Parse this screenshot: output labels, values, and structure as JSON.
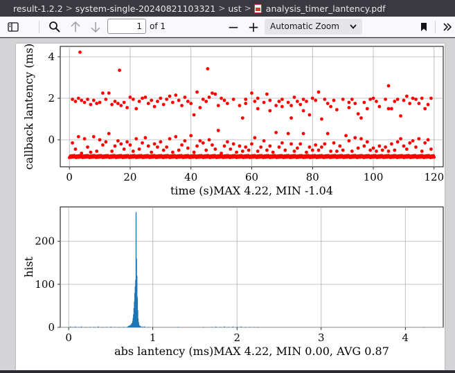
{
  "breadcrumb": {
    "items": [
      "result-1.2.2",
      "system-single-20240821103321",
      "ust"
    ],
    "file_name": "analysis_timer_lantency.pdf",
    "separator": ">"
  },
  "toolbar": {
    "page_number": "1",
    "page_count": "of 1",
    "zoom": "Automatic Zoom",
    "zoom_out_label": "−",
    "zoom_in_label": "+",
    "icons": [
      "sidebar-toggle-icon",
      "search-icon",
      "arrow-up-icon",
      "arrow-down-icon",
      "chevron-down-icon",
      "bookmark-icon",
      "double-chevron-right-icon"
    ]
  },
  "chart_data": [
    {
      "type": "scatter",
      "xlabel": "time (s)MAX 4.22, MIN -1.04",
      "ylabel": "callback lantency (ms)",
      "xlim": [
        -3,
        123
      ],
      "ylim": [
        -1.3,
        4.5
      ],
      "xticks": [
        0,
        20,
        40,
        60,
        80,
        100,
        120
      ],
      "yticks": [
        0,
        2,
        4
      ],
      "grid": true,
      "color": "#ff0000",
      "baseline": -0.8,
      "outliers": [
        [
          3.5,
          4.22
        ],
        [
          16.5,
          3.35
        ],
        [
          45.5,
          3.42
        ],
        [
          105,
          2.6
        ],
        [
          1,
          1.95
        ],
        [
          2,
          1.85
        ],
        [
          3,
          2.0
        ],
        [
          4,
          1.9
        ],
        [
          5,
          1.8
        ],
        [
          6,
          1.95
        ],
        [
          7,
          1.7
        ],
        [
          8,
          1.9
        ],
        [
          9,
          1.75
        ],
        [
          10,
          1.8
        ],
        [
          11,
          2.25
        ],
        [
          12,
          1.95
        ],
        [
          13,
          2.25
        ],
        [
          14,
          1.7
        ],
        [
          15,
          1.85
        ],
        [
          16,
          1.75
        ],
        [
          17,
          1.65
        ],
        [
          18,
          1.8
        ],
        [
          19,
          1.55
        ],
        [
          20,
          2.05
        ],
        [
          21,
          1.95
        ],
        [
          22,
          1.5
        ],
        [
          23,
          1.85
        ],
        [
          24,
          2.0
        ],
        [
          25,
          2.05
        ],
        [
          26,
          1.75
        ],
        [
          27,
          1.9
        ],
        [
          28,
          1.6
        ],
        [
          29,
          1.85
        ],
        [
          30,
          2.0
        ],
        [
          31,
          1.7
        ],
        [
          32,
          1.95
        ],
        [
          33,
          2.1
        ],
        [
          34,
          1.8
        ],
        [
          35,
          2.15
        ],
        [
          36,
          1.9
        ],
        [
          37,
          1.65
        ],
        [
          38,
          2.05
        ],
        [
          39,
          1.85
        ],
        [
          40,
          1.75
        ],
        [
          41,
          1.2
        ],
        [
          42,
          2.3
        ],
        [
          43,
          1.55
        ],
        [
          44,
          1.95
        ],
        [
          45,
          1.85
        ],
        [
          46,
          2.05
        ],
        [
          47,
          2.25
        ],
        [
          48,
          2.2
        ],
        [
          50,
          2.0
        ],
        [
          52,
          1.75
        ],
        [
          54,
          1.95
        ],
        [
          56,
          1.65
        ],
        [
          57,
          1.05
        ],
        [
          58,
          1.75
        ],
        [
          60,
          2.25
        ],
        [
          61,
          1.85
        ],
        [
          62,
          2.0
        ],
        [
          64,
          1.8
        ],
        [
          65,
          2.2
        ],
        [
          66,
          1.9
        ],
        [
          68,
          1.65
        ],
        [
          69,
          1.85
        ],
        [
          70,
          1.95
        ],
        [
          72,
          1.8
        ],
        [
          73,
          1.65
        ],
        [
          74,
          2.05
        ],
        [
          75,
          1.85
        ],
        [
          76,
          1.7
        ],
        [
          77,
          1.95
        ],
        [
          78,
          1.85
        ],
        [
          79,
          1.2
        ],
        [
          80,
          2.0
        ],
        [
          82,
          2.3
        ],
        [
          84,
          1.95
        ],
        [
          85,
          1.75
        ],
        [
          86,
          1.6
        ],
        [
          87,
          1.9
        ],
        [
          88,
          1.45
        ],
        [
          90,
          1.95
        ],
        [
          92,
          1.55
        ],
        [
          93,
          1.95
        ],
        [
          95,
          1.25
        ],
        [
          96,
          1.05
        ],
        [
          97,
          1.8
        ],
        [
          98,
          1.5
        ],
        [
          99,
          1.95
        ],
        [
          100,
          2.0
        ],
        [
          101,
          1.85
        ],
        [
          102,
          1.6
        ],
        [
          104,
          1.95
        ],
        [
          105,
          1.5
        ],
        [
          106,
          1.5
        ],
        [
          107,
          1.85
        ],
        [
          108,
          1.95
        ],
        [
          109,
          1.15
        ],
        [
          110,
          1.9
        ],
        [
          111,
          2.1
        ],
        [
          112,
          1.75
        ],
        [
          113,
          2.0
        ],
        [
          114,
          1.95
        ],
        [
          115,
          1.75
        ],
        [
          116,
          2.0
        ],
        [
          117,
          1.5
        ],
        [
          118,
          1.7
        ],
        [
          119,
          2.0
        ],
        [
          58,
          1.95
        ],
        [
          62,
          1.5
        ],
        [
          70,
          1.6
        ],
        [
          77,
          1.4
        ],
        [
          81,
          1.9
        ],
        [
          83,
          1.0
        ],
        [
          92,
          1.8
        ],
        [
          66,
          1.4
        ],
        [
          73,
          1.05
        ],
        [
          49,
          1.65
        ],
        [
          51,
          1.9
        ],
        [
          94,
          1.75
        ],
        [
          1,
          -0.15
        ],
        [
          2,
          -0.45
        ],
        [
          3,
          0.15
        ],
        [
          4,
          -0.65
        ],
        [
          5,
          0.05
        ],
        [
          6,
          -0.35
        ],
        [
          7,
          -0.6
        ],
        [
          8,
          0.15
        ],
        [
          9,
          -0.55
        ],
        [
          10,
          0.0
        ],
        [
          11,
          -0.25
        ],
        [
          12,
          -0.1
        ],
        [
          13,
          0.3
        ],
        [
          14,
          -0.55
        ],
        [
          15,
          -0.3
        ],
        [
          16,
          -0.05
        ],
        [
          17,
          -0.2
        ],
        [
          18,
          -0.45
        ],
        [
          19,
          -0.1
        ],
        [
          20,
          -0.25
        ],
        [
          21,
          -0.55
        ],
        [
          22,
          0.05
        ],
        [
          23,
          -0.45
        ],
        [
          24,
          -0.15
        ],
        [
          25,
          0.1
        ],
        [
          26,
          -0.3
        ],
        [
          27,
          -0.6
        ],
        [
          28,
          -0.2
        ],
        [
          29,
          -0.35
        ],
        [
          30,
          -0.1
        ],
        [
          31,
          -0.5
        ],
        [
          32,
          -0.35
        ],
        [
          33,
          0.05
        ],
        [
          34,
          -0.6
        ],
        [
          35,
          0.15
        ],
        [
          36,
          -0.5
        ],
        [
          37,
          -0.25
        ],
        [
          38,
          -0.05
        ],
        [
          39,
          -0.4
        ],
        [
          40,
          0.2
        ],
        [
          41,
          -0.6
        ],
        [
          42,
          -0.3
        ],
        [
          43,
          -0.05
        ],
        [
          44,
          -0.15
        ],
        [
          45,
          -0.5
        ],
        [
          46,
          0.0
        ],
        [
          47,
          -0.25
        ],
        [
          48,
          -0.45
        ],
        [
          49,
          0.45
        ],
        [
          50,
          -0.65
        ],
        [
          51,
          -0.3
        ],
        [
          52,
          -0.1
        ],
        [
          53,
          -0.45
        ],
        [
          54,
          -0.2
        ],
        [
          55,
          -0.6
        ],
        [
          56,
          -0.3
        ],
        [
          57,
          -0.55
        ],
        [
          58,
          -0.35
        ],
        [
          59,
          -0.5
        ],
        [
          60,
          -0.2
        ],
        [
          61,
          0.1
        ],
        [
          62,
          -0.55
        ],
        [
          63,
          -0.35
        ],
        [
          64,
          -0.05
        ],
        [
          65,
          -0.5
        ],
        [
          66,
          -0.3
        ],
        [
          67,
          -0.6
        ],
        [
          68,
          0.35
        ],
        [
          69,
          -0.35
        ],
        [
          70,
          -0.15
        ],
        [
          71,
          -0.5
        ],
        [
          72,
          0.3
        ],
        [
          73,
          -0.2
        ],
        [
          74,
          -0.55
        ],
        [
          75,
          -0.4
        ],
        [
          76,
          -0.2
        ],
        [
          77,
          0.3
        ],
        [
          78,
          -0.6
        ],
        [
          79,
          -0.35
        ],
        [
          80,
          -0.5
        ],
        [
          81,
          -0.25
        ],
        [
          82,
          -0.5
        ],
        [
          83,
          -0.35
        ],
        [
          84,
          -0.2
        ],
        [
          85,
          0.3
        ],
        [
          86,
          -0.55
        ],
        [
          87,
          -0.15
        ],
        [
          88,
          -0.55
        ],
        [
          89,
          -0.3
        ],
        [
          90,
          -0.5
        ],
        [
          91,
          0.2
        ],
        [
          92,
          -0.05
        ],
        [
          93,
          -0.55
        ],
        [
          94,
          0.1
        ],
        [
          95,
          -0.4
        ],
        [
          96,
          0.05
        ],
        [
          97,
          -0.3
        ],
        [
          98,
          -0.1
        ],
        [
          99,
          -0.5
        ],
        [
          100,
          -0.4
        ],
        [
          101,
          -0.55
        ],
        [
          102,
          -0.3
        ],
        [
          103,
          -0.5
        ],
        [
          104,
          -0.35
        ],
        [
          105,
          -0.55
        ],
        [
          106,
          -0.2
        ],
        [
          107,
          -0.5
        ],
        [
          108,
          -0.1
        ],
        [
          109,
          0.05
        ],
        [
          110,
          -0.3
        ],
        [
          111,
          -0.45
        ],
        [
          112,
          -0.15
        ],
        [
          113,
          -0.05
        ],
        [
          114,
          -0.35
        ],
        [
          115,
          0.05
        ],
        [
          116,
          -0.55
        ],
        [
          117,
          -0.15
        ],
        [
          118,
          0.0
        ],
        [
          119,
          -0.45
        ]
      ]
    },
    {
      "type": "bar",
      "xlabel": "abs lantency (ms)MAX 4.22, MIN 0.00, AVG 0.87",
      "ylabel": "hist",
      "xlim": [
        -0.1,
        4.45
      ],
      "ylim": [
        0,
        280
      ],
      "xticks": [
        0,
        1,
        2,
        3,
        4
      ],
      "yticks": [
        0,
        100,
        200
      ],
      "grid": true,
      "color": "#1f77b4",
      "bins": [
        [
          0.7,
          2
        ],
        [
          0.71,
          3
        ],
        [
          0.72,
          4
        ],
        [
          0.73,
          5
        ],
        [
          0.74,
          7
        ],
        [
          0.75,
          10
        ],
        [
          0.76,
          15
        ],
        [
          0.765,
          22
        ],
        [
          0.77,
          30
        ],
        [
          0.775,
          45
        ],
        [
          0.78,
          60
        ],
        [
          0.785,
          80
        ],
        [
          0.79,
          95
        ],
        [
          0.795,
          110
        ],
        [
          0.8,
          268
        ],
        [
          0.805,
          160
        ],
        [
          0.81,
          120
        ],
        [
          0.815,
          70
        ],
        [
          0.82,
          40
        ],
        [
          0.825,
          20
        ],
        [
          0.83,
          12
        ],
        [
          0.835,
          6
        ],
        [
          0.84,
          4
        ],
        [
          0.85,
          3
        ],
        [
          0.86,
          2
        ],
        [
          0.88,
          2
        ],
        [
          0.9,
          2
        ],
        [
          0.95,
          1
        ],
        [
          0.02,
          2
        ],
        [
          0.05,
          1
        ],
        [
          0.08,
          2
        ],
        [
          0.12,
          1
        ],
        [
          0.15,
          2
        ],
        [
          0.2,
          1
        ],
        [
          0.25,
          1
        ],
        [
          0.3,
          1
        ],
        [
          0.35,
          2
        ],
        [
          0.4,
          1
        ],
        [
          0.45,
          1
        ],
        [
          0.5,
          2
        ],
        [
          0.55,
          1
        ],
        [
          0.6,
          1
        ],
        [
          0.65,
          1
        ],
        [
          1.0,
          1
        ],
        [
          1.3,
          1
        ],
        [
          1.6,
          1
        ],
        [
          1.7,
          1
        ],
        [
          1.75,
          2
        ],
        [
          1.8,
          1
        ],
        [
          1.85,
          2
        ],
        [
          1.9,
          1
        ],
        [
          1.95,
          2
        ],
        [
          2.0,
          1
        ],
        [
          2.05,
          2
        ],
        [
          2.1,
          1
        ],
        [
          2.15,
          1
        ],
        [
          2.2,
          1
        ],
        [
          2.25,
          1
        ],
        [
          4.22,
          1
        ]
      ]
    }
  ]
}
